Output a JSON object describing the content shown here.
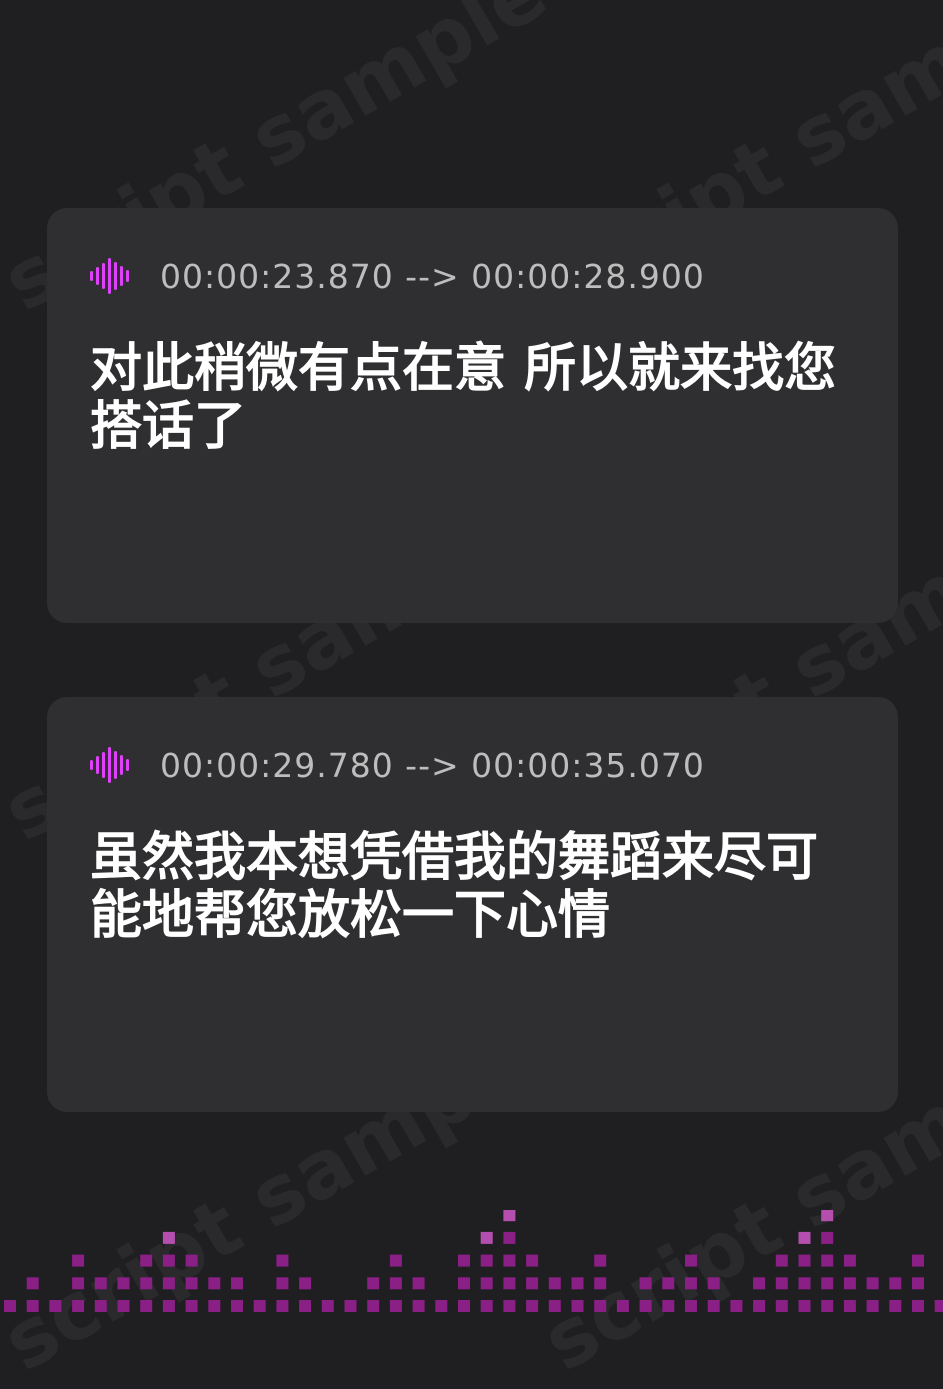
{
  "watermark": {
    "text": "script sample"
  },
  "accent_colors": {
    "icon": "#e040fb",
    "equalizer": "#8a1f86",
    "equalizer_peak": "#b44fb0"
  },
  "cards": [
    {
      "icon": "audio-wave-icon",
      "timestamp": "00:00:23.870 --> 00:00:28.900",
      "text": "对此稍微有点在意 所以就来找您搭话了"
    },
    {
      "icon": "audio-wave-icon",
      "timestamp": "00:00:29.780 --> 00:00:35.070",
      "text": "虽然我本想凭借我的舞蹈来尽可能地帮您放松一下心情"
    }
  ]
}
